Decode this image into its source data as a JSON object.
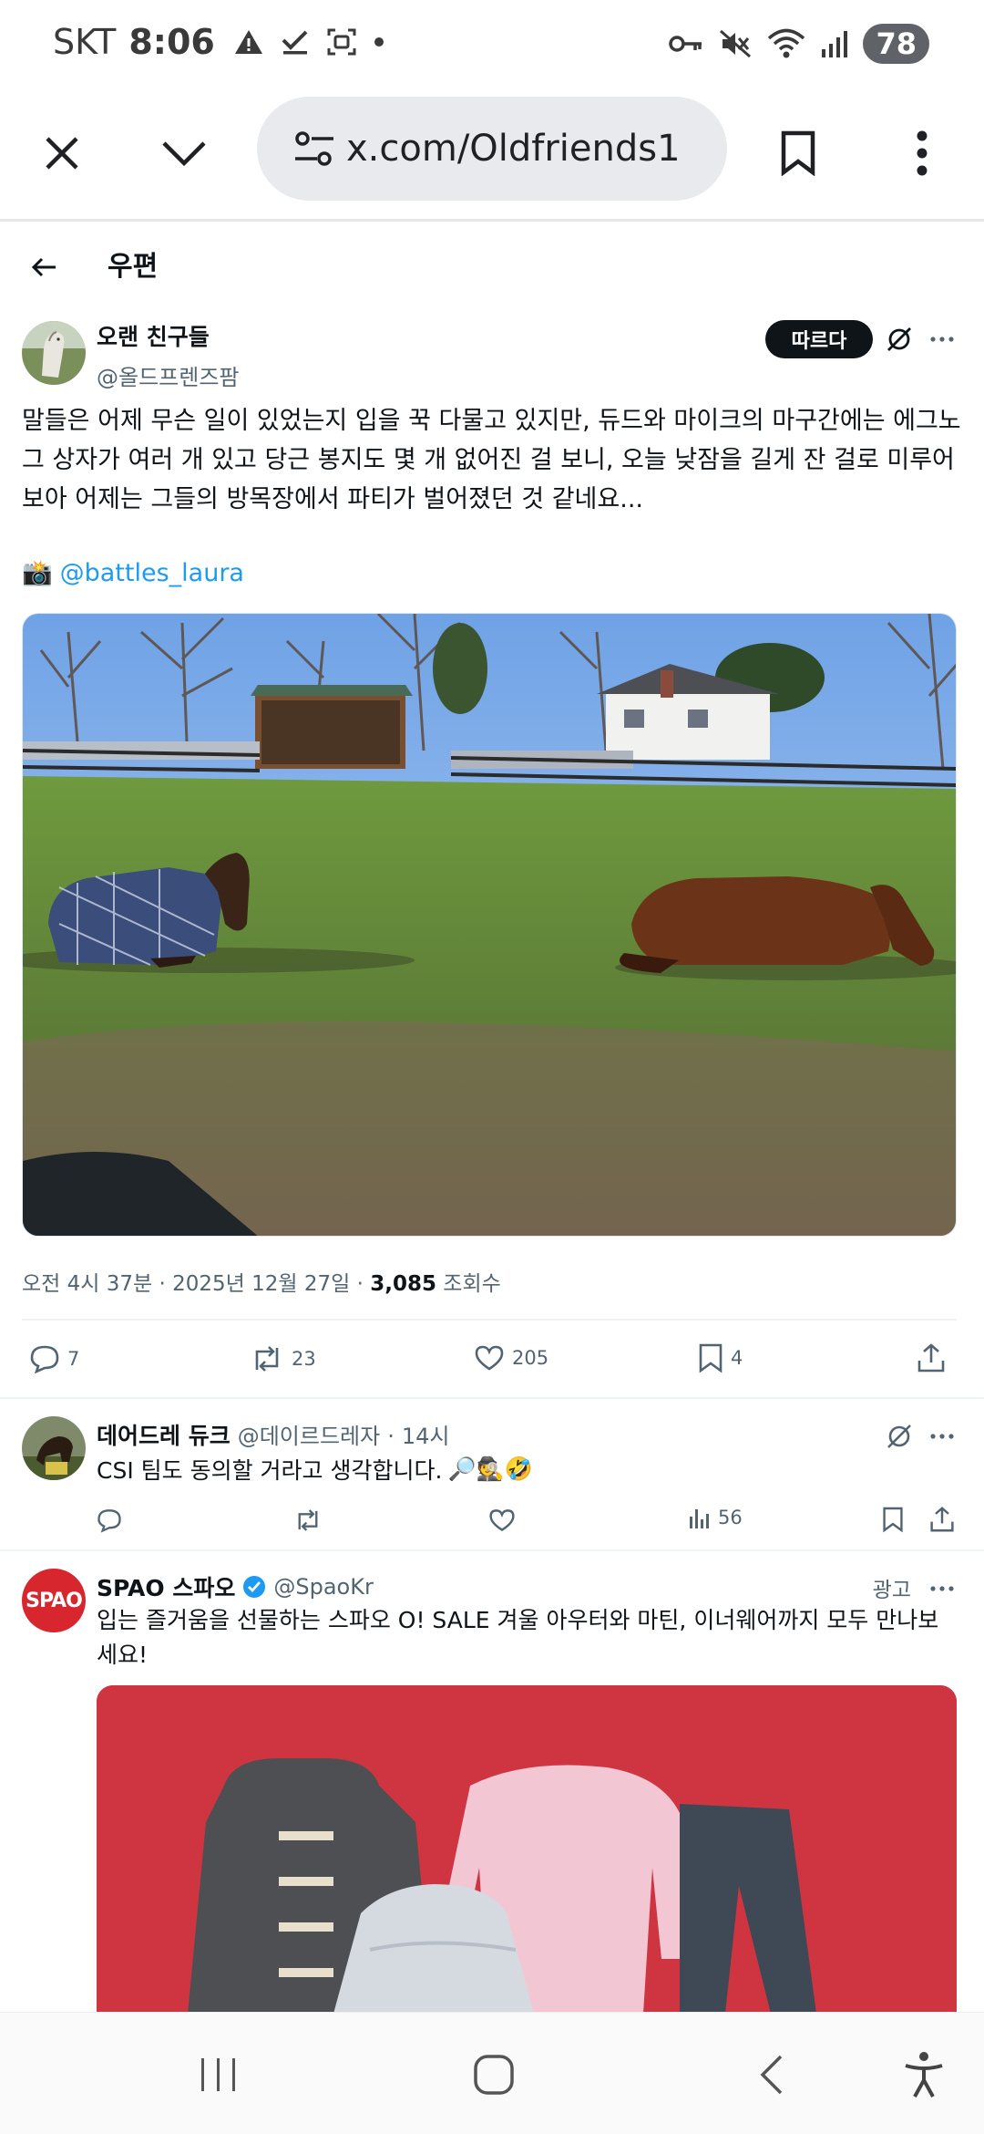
{
  "status_bar": {
    "carrier": "SKT",
    "time": "8:06",
    "battery": "78"
  },
  "browser": {
    "url": "x.com/Oldfriends1"
  },
  "header": {
    "title": "우편"
  },
  "post": {
    "author_name": "오랜 친구들",
    "author_handle": "@올드프렌즈팜",
    "follow_label": "따르다",
    "text": "말들은 어제 무슨 일이 있었는지 입을 꾹 다물고 있지만, 듀드와 마이크의 마구간에는 에그노그 상자가 여러 개 있고 당근 봉지도 몇 개 없어진 걸 보니, 오늘 낮잠을 길게 잔 걸로 미루어 보아 어제는 그들의 방목장에서 파티가 벌어졌던 것 같네요...",
    "credit_emoji": "📸",
    "credit_handle": "@battles_laura",
    "time": "오전 4시 37분",
    "date": "2025년 12월 27일",
    "views_count": "3,085",
    "views_label": "조회수",
    "replies": "7",
    "reposts": "23",
    "likes": "205",
    "bookmarks": "4"
  },
  "reply": {
    "author_name": "데어드레 듀크",
    "author_handle": "@데이르드레자",
    "age": "14시",
    "text": "CSI 팀도 동의할 거라고 생각합니다.",
    "emojis": "🔎🕵🤣",
    "views": "56"
  },
  "ad": {
    "avatar_text": "SPAO",
    "author_name": "SPAO 스파오",
    "author_handle": "@SpaoKr",
    "label": "광고",
    "text": "입는 즐거움을 선물하는 스파오 O! SALE 겨울 아우터와 마틴, 이너웨어까지 모두 만나보세요!"
  },
  "colors": {
    "link": "#1d9bf0",
    "ad_background": "#cf3540",
    "verified": "#1d9bf0"
  }
}
